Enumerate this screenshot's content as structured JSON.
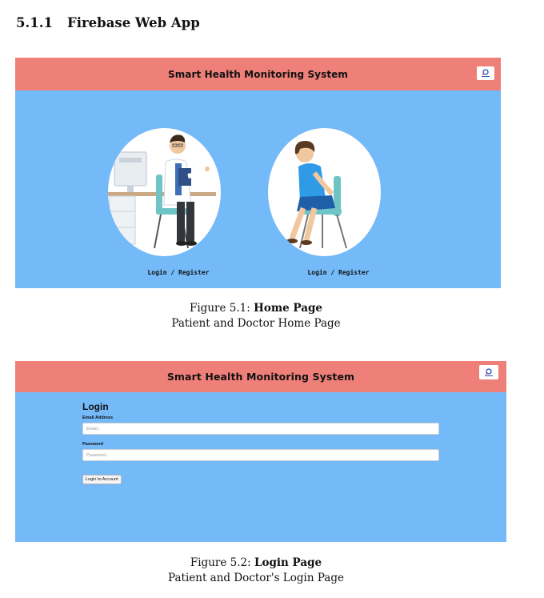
{
  "section": {
    "number": "5.1.1",
    "title": "Firebase Web App"
  },
  "home_page": {
    "app_title": "Smart Health Monitoring System",
    "doctor_link": "Login / Register",
    "patient_link": "Login / Register"
  },
  "figure1": {
    "label": "Figure 5.1:",
    "title": "Home Page",
    "subtitle": "Patient and Doctor Home Page"
  },
  "login_page": {
    "app_title": "Smart Health Monitoring System",
    "heading": "Login",
    "email_label": "Email Address",
    "email_placeholder": "Email..",
    "password_label": "Password",
    "password_placeholder": "Password...",
    "submit_label": "Login to Account"
  },
  "figure2": {
    "label": "Figure 5.2:",
    "title": "Login Page",
    "subtitle": "Patient and Doctor's Login Page"
  },
  "colors": {
    "header": "#ef8079",
    "background": "#74b9f8"
  }
}
